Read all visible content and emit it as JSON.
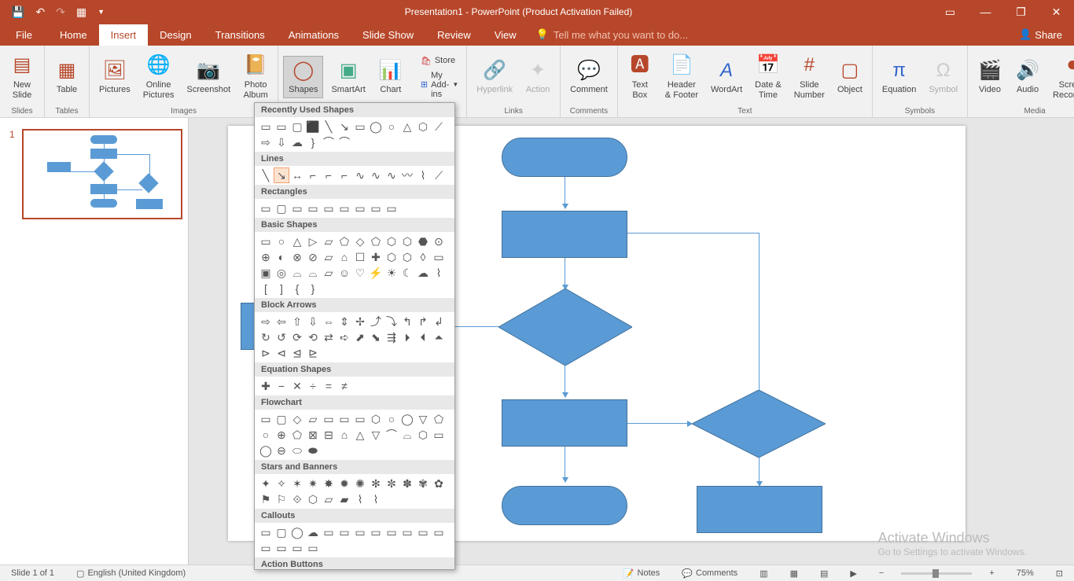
{
  "titlebar": {
    "title": "Presentation1 - PowerPoint (Product Activation Failed)"
  },
  "tabs": {
    "file": "File",
    "home": "Home",
    "insert": "Insert",
    "design": "Design",
    "transitions": "Transitions",
    "animations": "Animations",
    "slideshow": "Slide Show",
    "review": "Review",
    "view": "View",
    "tellme": "Tell me what you want to do...",
    "share": "Share"
  },
  "ribbon": {
    "slides": {
      "label": "Slides",
      "newslide": "New\nSlide"
    },
    "tables": {
      "label": "Tables",
      "table": "Table"
    },
    "images": {
      "label": "Images",
      "pictures": "Pictures",
      "online": "Online\nPictures",
      "screenshot": "Screenshot",
      "album": "Photo\nAlbum"
    },
    "illustrations": {
      "shapes": "Shapes",
      "smartart": "SmartArt",
      "chart": "Chart"
    },
    "addins": {
      "store": "Store",
      "myaddins": "My Add-ins"
    },
    "links": {
      "label": "Links",
      "hyperlink": "Hyperlink",
      "action": "Action"
    },
    "comments": {
      "label": "Comments",
      "comment": "Comment"
    },
    "text": {
      "label": "Text",
      "textbox": "Text\nBox",
      "header": "Header\n& Footer",
      "wordart": "WordArt",
      "datetime": "Date &\nTime",
      "slidenum": "Slide\nNumber",
      "object": "Object"
    },
    "symbols": {
      "label": "Symbols",
      "equation": "Equation",
      "symbol": "Symbol"
    },
    "media": {
      "label": "Media",
      "video": "Video",
      "audio": "Audio",
      "screenrec": "Screen\nRecording"
    }
  },
  "gallery": {
    "categories": [
      "Recently Used Shapes",
      "Lines",
      "Rectangles",
      "Basic Shapes",
      "Block Arrows",
      "Equation Shapes",
      "Flowchart",
      "Stars and Banners",
      "Callouts",
      "Action Buttons"
    ]
  },
  "status": {
    "slide": "Slide 1 of 1",
    "lang": "English (United Kingdom)",
    "notes": "Notes",
    "comments": "Comments",
    "zoom": "75%"
  },
  "thumb": {
    "num": "1"
  },
  "watermark": {
    "title": "Activate Windows",
    "sub": "Go to Settings to activate Windows."
  }
}
